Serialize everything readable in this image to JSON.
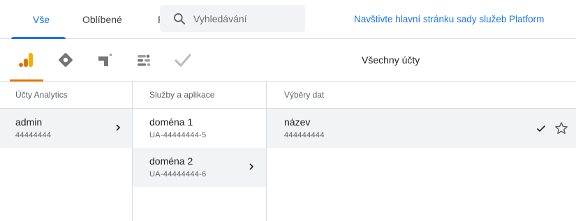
{
  "tabs": {
    "all": "Vše",
    "favorites": "Oblíbené",
    "third_partial": "R"
  },
  "search": {
    "placeholder": "Vyhledávání"
  },
  "platform_link": "Navštivte hlavní stránku sady služeb Platform",
  "products": {
    "icons": [
      "analytics-icon",
      "tag-manager-icon",
      "optimize-icon",
      "data-studio-icon",
      "surveys-icon"
    ],
    "title": "Všechny účty",
    "accent_color": "#e37400"
  },
  "columns": {
    "accounts": {
      "header": "Účty Analytics",
      "items": [
        {
          "name": "admin",
          "id": "44444444"
        }
      ]
    },
    "properties": {
      "header": "Služby a aplikace",
      "items": [
        {
          "name": "doména 1",
          "id": "UA-44444444-5"
        },
        {
          "name": "doména 2",
          "id": "UA-44444444-6"
        }
      ]
    },
    "views": {
      "header": "Výběry dat",
      "items": [
        {
          "name": "název",
          "id": "444444444"
        }
      ]
    }
  },
  "colors": {
    "primary_blue": "#1a73e8",
    "selected_row": "#f1f3f4",
    "divider": "#dadce0"
  }
}
